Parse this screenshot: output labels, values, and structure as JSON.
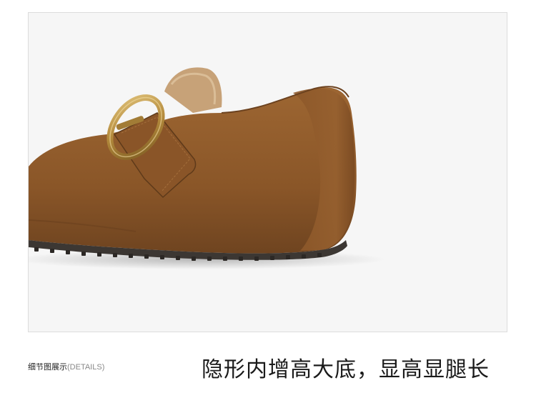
{
  "caption": {
    "label": "细节图展示",
    "sub": "(DETAILS)"
  },
  "headline": "隐形内增高大底，显高显腿长",
  "colors": {
    "suede": "#8f5a2b",
    "suede_shadow": "#6e4320",
    "fur_lining": "#c8a47a",
    "buckle": "#b8934a",
    "sole": "#3c3733",
    "background": "#f6f6f6"
  }
}
